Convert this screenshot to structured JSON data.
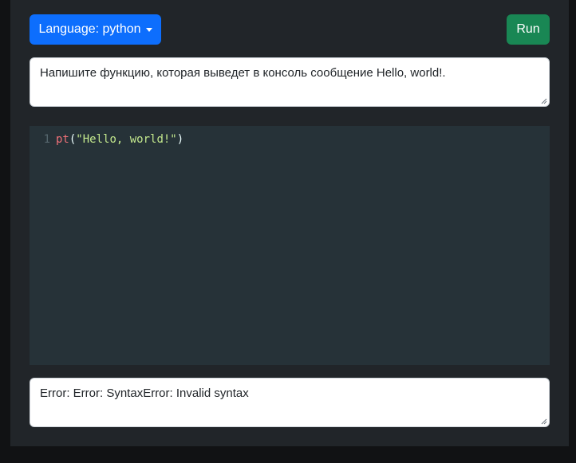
{
  "toolbar": {
    "language_label": "Language: python",
    "run_label": "Run"
  },
  "task": {
    "text": "Напишите функцию, которая выведет в консоль сообщение Hello, world!."
  },
  "editor": {
    "lines": [
      {
        "number": "1",
        "fn": "pt",
        "open": "(",
        "string": "\"Hello, world!\"",
        "close": ")"
      }
    ]
  },
  "output": {
    "text": "Error: Error: SyntaxError: Invalid syntax"
  },
  "colors": {
    "primary": "#0d6efd",
    "success": "#198754",
    "panel": "#212529",
    "editor_bg": "#263238",
    "token_fn": "#f07178",
    "token_string": "#c3e88d"
  },
  "icons": {
    "dropdown": "caret-down-icon",
    "resize": "resize-grip-icon"
  }
}
